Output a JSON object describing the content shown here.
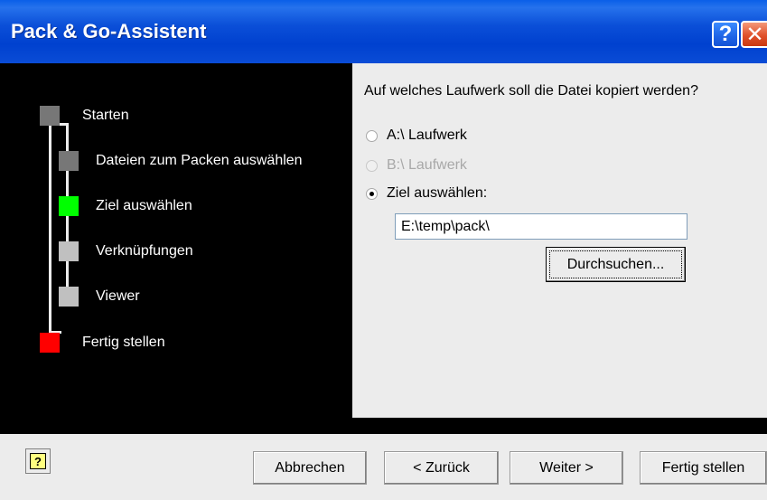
{
  "window": {
    "title": "Pack & Go-Assistent",
    "help_glyph": "?",
    "close_glyph": "✕"
  },
  "steps": [
    {
      "label": "Starten",
      "status_color": "#777777"
    },
    {
      "label": "Dateien zum Packen auswählen",
      "status_color": "#777777"
    },
    {
      "label": "Ziel auswählen",
      "status_color": "#00ff00"
    },
    {
      "label": "Verknüpfungen",
      "status_color": "#c0c0c0"
    },
    {
      "label": "Viewer",
      "status_color": "#c0c0c0"
    },
    {
      "label": "Fertig stellen",
      "status_color": "#ff0000"
    }
  ],
  "content": {
    "question": "Auf welches Laufwerk soll die Datei kopiert werden?",
    "options": [
      {
        "label": "A:\\ Laufwerk",
        "checked": false,
        "disabled": false
      },
      {
        "label": "B:\\ Laufwerk",
        "checked": false,
        "disabled": true
      },
      {
        "label": "Ziel auswählen:",
        "checked": true,
        "disabled": false
      }
    ],
    "path_value": "E:\\temp\\pack\\",
    "browse_label": "Durchsuchen..."
  },
  "buttons": {
    "help_icon": "help-icon",
    "cancel": "Abbrechen",
    "back": "< Zurück",
    "next": "Weiter >",
    "finish": "Fertig stellen"
  }
}
